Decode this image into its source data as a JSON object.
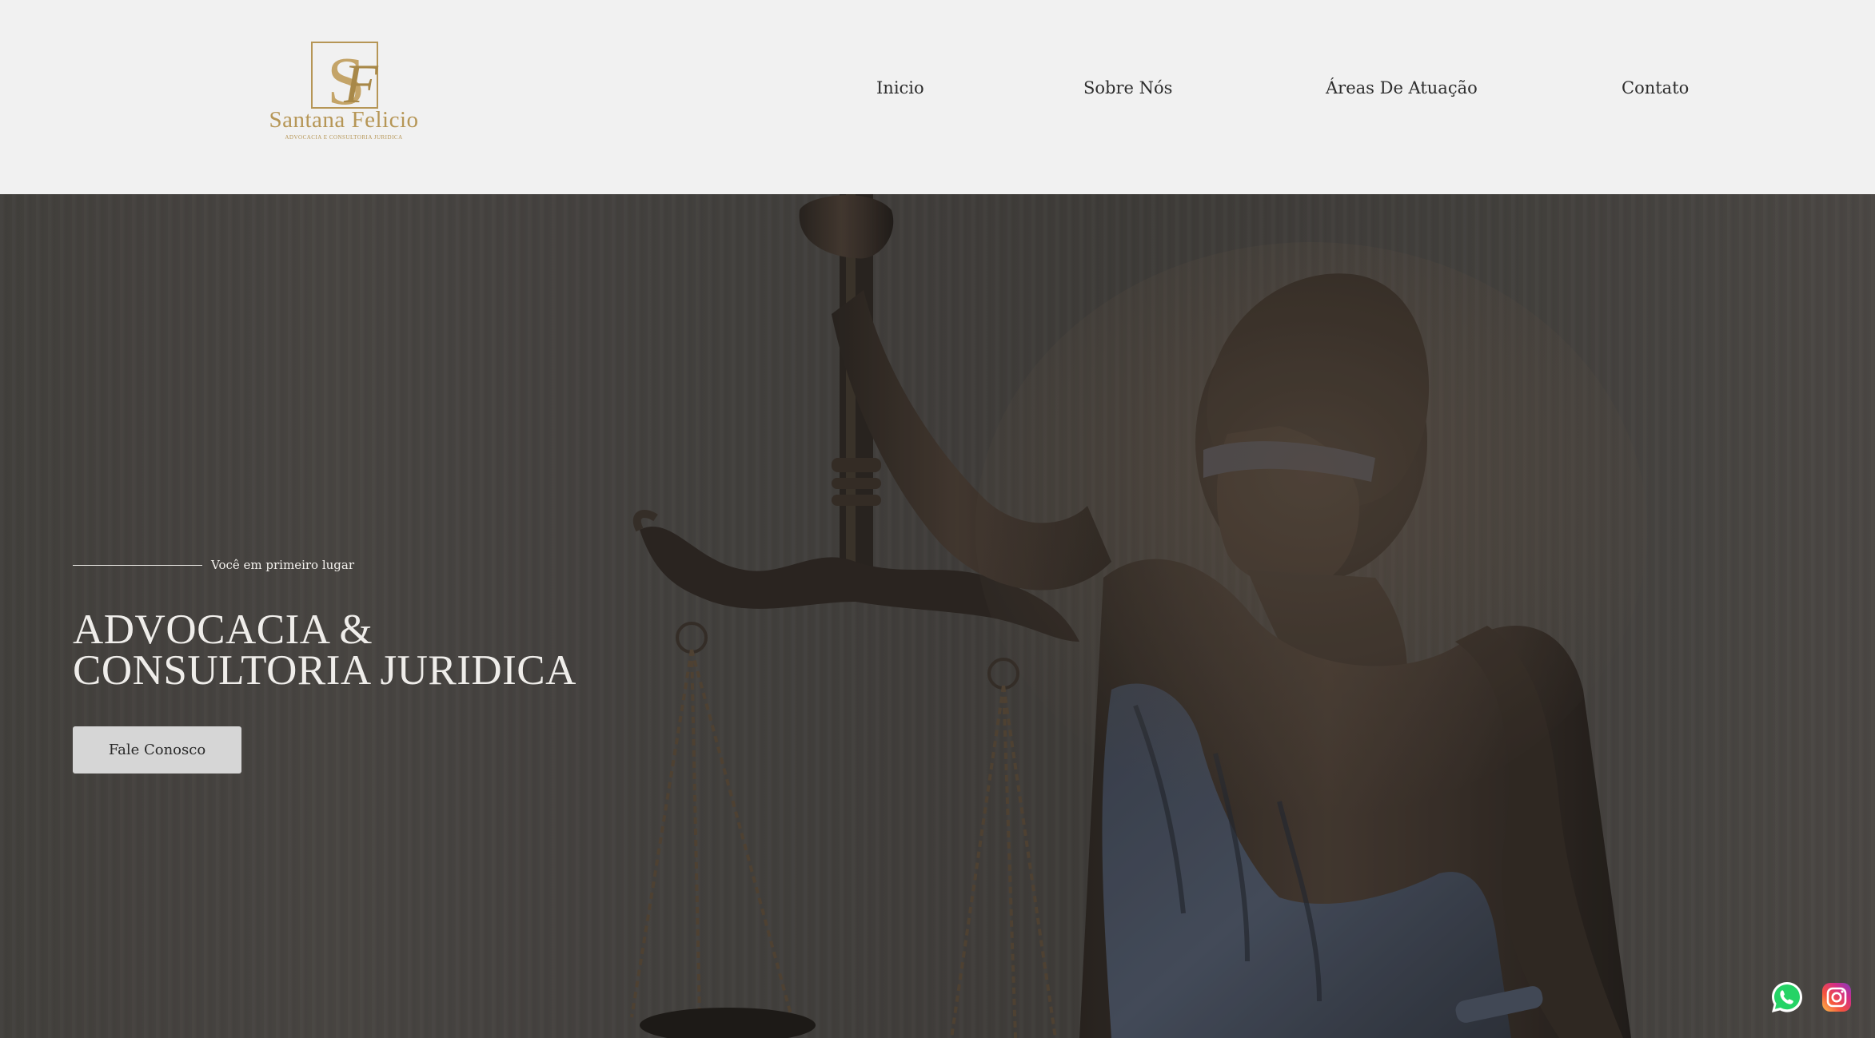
{
  "brand": {
    "name": "Santana Felicio",
    "tagline": "ADVOCACIA E CONSULTORIA JURIDICA",
    "gold_color": "#b69656"
  },
  "nav": {
    "items": [
      {
        "label": "Inicio"
      },
      {
        "label": "Sobre Nós"
      },
      {
        "label": "Áreas De Atuação"
      },
      {
        "label": "Contato"
      }
    ]
  },
  "hero": {
    "eyebrow": "Você em primeiro lugar",
    "title_line1": "ADVOCACIA &",
    "title_line2": "CONSULTORIA JURIDICA",
    "cta_label": "Fale Conosco"
  },
  "social": {
    "whatsapp_icon": "whatsapp-icon",
    "instagram_icon": "instagram-icon",
    "whatsapp_color": "#25d366"
  }
}
